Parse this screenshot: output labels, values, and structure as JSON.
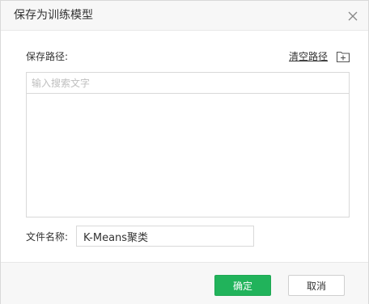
{
  "dialog": {
    "title": "保存为训练模型",
    "close_icon": "close-icon"
  },
  "path": {
    "label": "保存路径:",
    "clear_label": "清空路径",
    "new_folder_icon": "new-folder-icon"
  },
  "search": {
    "placeholder": "输入搜索文字",
    "value": ""
  },
  "filename": {
    "label": "文件名称:",
    "value": "K-Means聚类"
  },
  "footer": {
    "ok_label": "确定",
    "cancel_label": "取消"
  },
  "colors": {
    "accent": "#21b35b",
    "header_bg": "#f7f7f7",
    "border": "#d9d9d9"
  }
}
